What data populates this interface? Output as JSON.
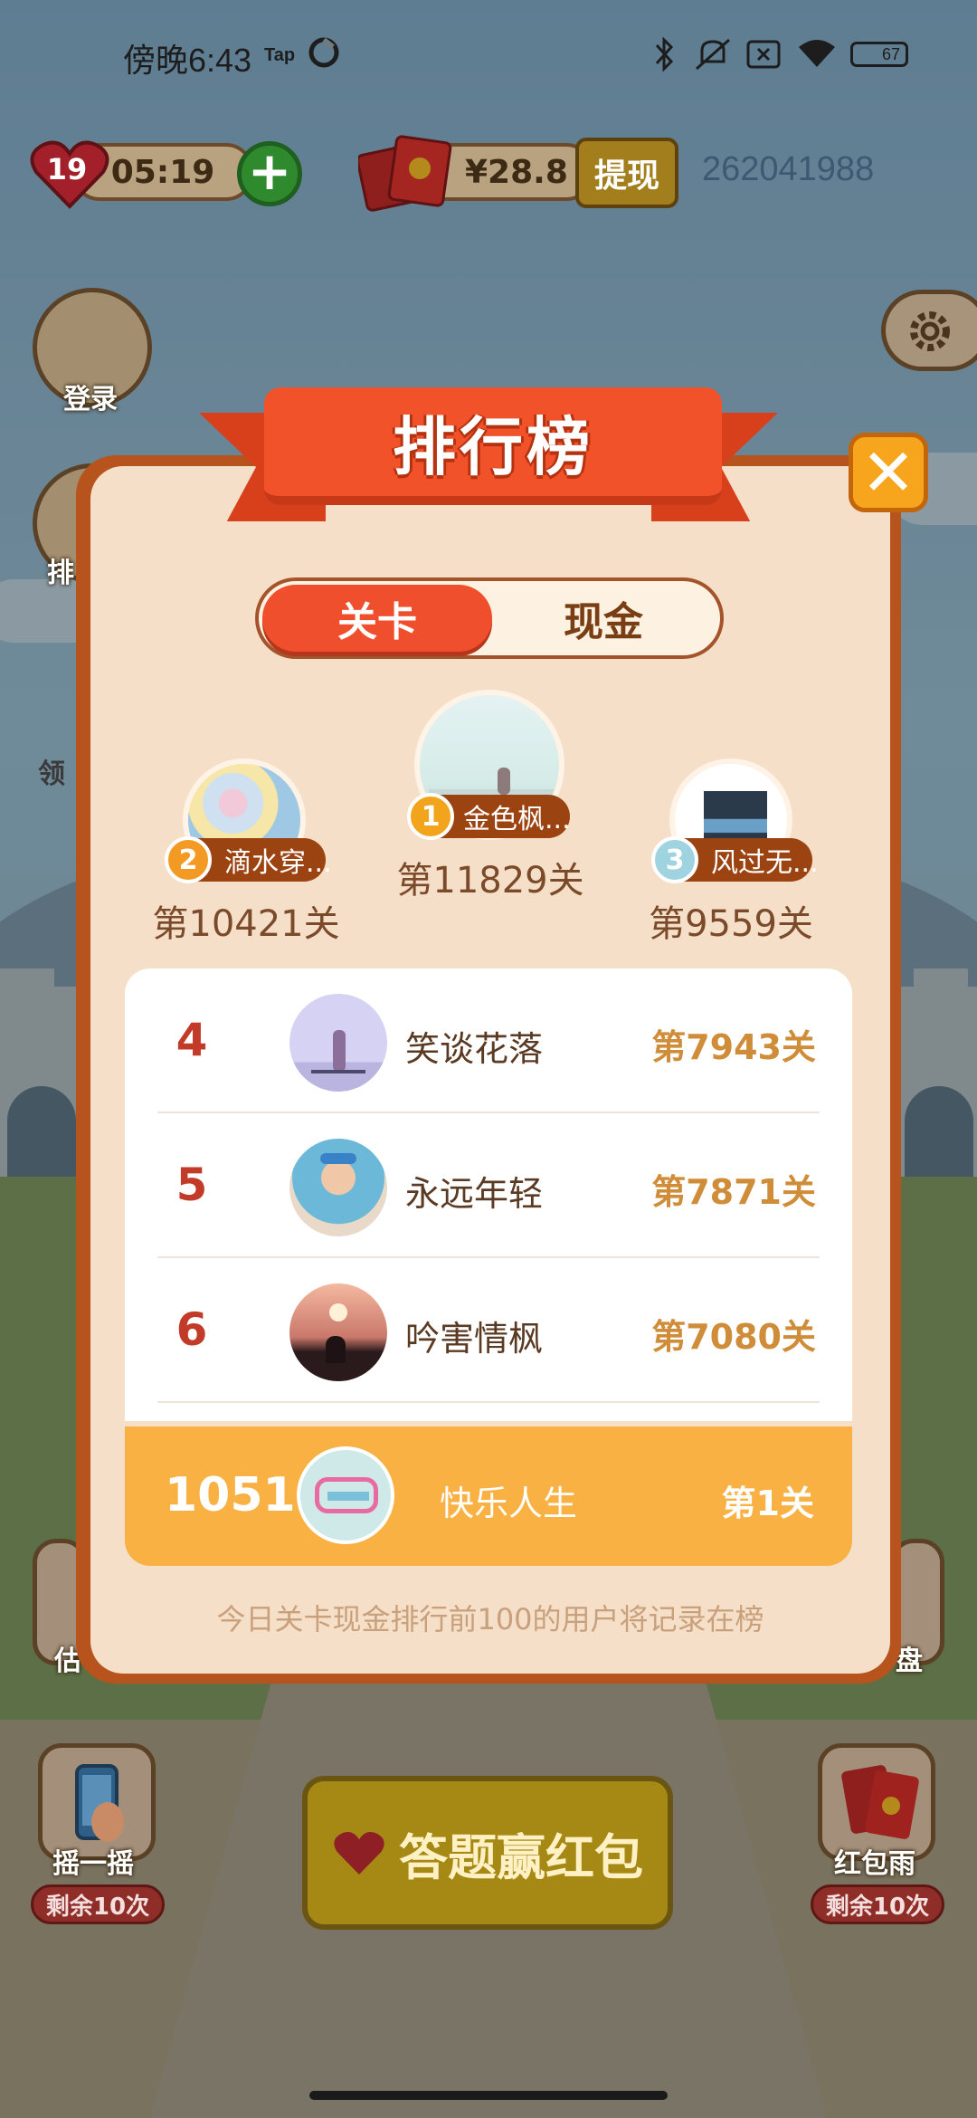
{
  "status_bar": {
    "time": "傍晚6:43",
    "carrier_badge": "Tap",
    "battery": "67"
  },
  "hud": {
    "lives": "19",
    "timer": "05:19",
    "cash": "¥28.8",
    "withdraw_label": "提现",
    "user_id": "262041988"
  },
  "side": {
    "login_label": "登录",
    "rank_label_partial": "排",
    "collect_label_partial": "领",
    "left_bottom_partial": "估",
    "right_bottom_partial": "盘"
  },
  "bottom": {
    "shake_label": "摇一摇",
    "shake_remaining": "剩余10次",
    "answer_label": "答题赢红包",
    "rain_label": "红包雨",
    "rain_remaining": "剩余10次"
  },
  "dialog": {
    "title": "排行榜",
    "close_glyph": "✕",
    "tabs": [
      {
        "label": "关卡",
        "active": true
      },
      {
        "label": "现金",
        "active": false
      }
    ],
    "podium": [
      {
        "rank": "1",
        "name": "金色枫...",
        "level": "第11829关",
        "medal_color": "#f2a51c"
      },
      {
        "rank": "2",
        "name": "滴水穿...",
        "level": "第10421关",
        "medal_color": "#f39a24"
      },
      {
        "rank": "3",
        "name": "风过无...",
        "level": "第9559关",
        "medal_color": "#9fd3e0"
      }
    ],
    "rows": [
      {
        "rank": "4",
        "name": "笑谈花落",
        "level": "第7943关"
      },
      {
        "rank": "5",
        "name": "永远年轻",
        "level": "第7871关"
      },
      {
        "rank": "6",
        "name": "吟害情枫",
        "level": "第7080关"
      }
    ],
    "mine": {
      "rank": "1051",
      "name": "快乐人生",
      "level": "第1关"
    },
    "note": "今日关卡现金排行前100的用户将记录在榜"
  }
}
